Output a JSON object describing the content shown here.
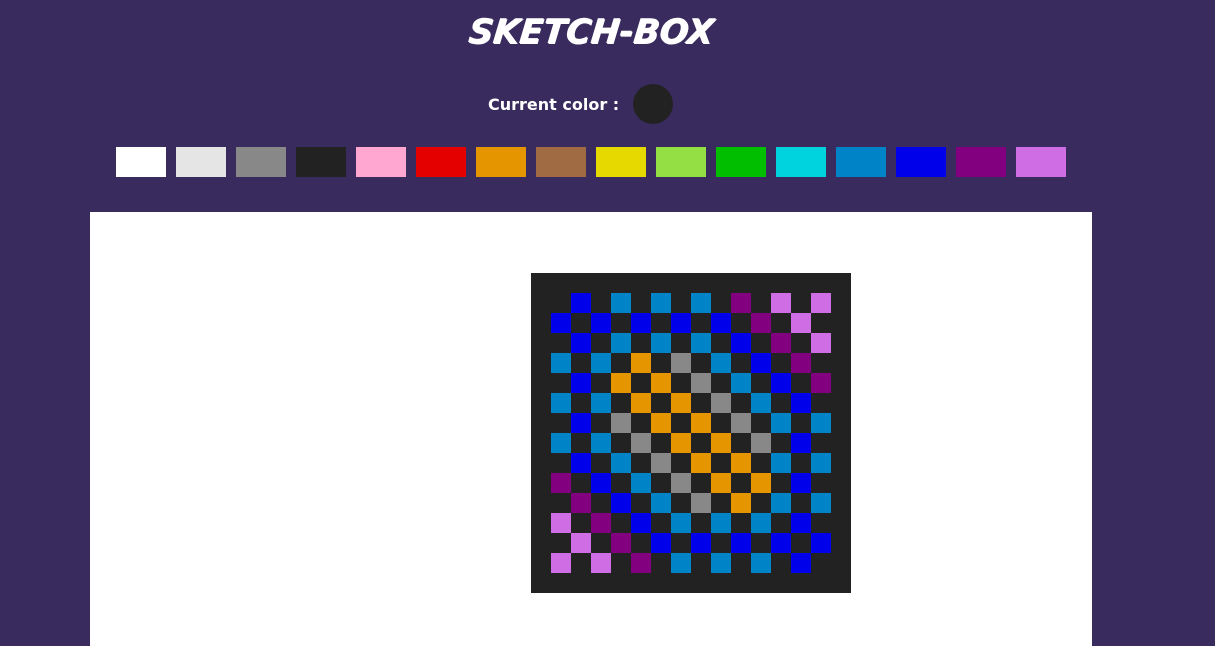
{
  "app": {
    "title": "SKETCH-BOX"
  },
  "current": {
    "label": "Current color :",
    "color": "#222222"
  },
  "palette": [
    "#ffffff",
    "#e5e5e5",
    "#888888",
    "#222222",
    "#ffa7d1",
    "#e50000",
    "#e59500",
    "#a06a42",
    "#e5d900",
    "#94e044",
    "#02be01",
    "#00d3dd",
    "#0083c7",
    "#0000ea",
    "#820080",
    "#cf6ee4"
  ],
  "grid": {
    "cols": 16,
    "rows": 16,
    "legend": {
      ".": "#222222",
      "B": "#0000ea",
      "S": "#0083c7",
      "P": "#820080",
      "L": "#cf6ee4",
      "O": "#e59500",
      "G": "#888888"
    },
    "pixels": [
      "................",
      "..B.S.S.S.P.L.L.",
      ".B.B.B.B.B.P.L..",
      "..B.S.S.S.B.P.L.",
      ".S.S.O.G.S.B.P..",
      "..B.O.O.G.S.B.P.",
      ".S.S.O.O.G.S.B..",
      "..B.G.O.O.G.S.S.",
      ".S.S.G.O.O.G.B..",
      "..B.S.G.O.O.S.S.",
      ".P.B.S.G.O.O.B..",
      "..P.B.S.G.O.S.S.",
      ".L.P.B.S.S.S.B..",
      "..L.P.B.B.B.B.B.",
      ".L.L.P.S.S.S.B..",
      "................"
    ]
  }
}
